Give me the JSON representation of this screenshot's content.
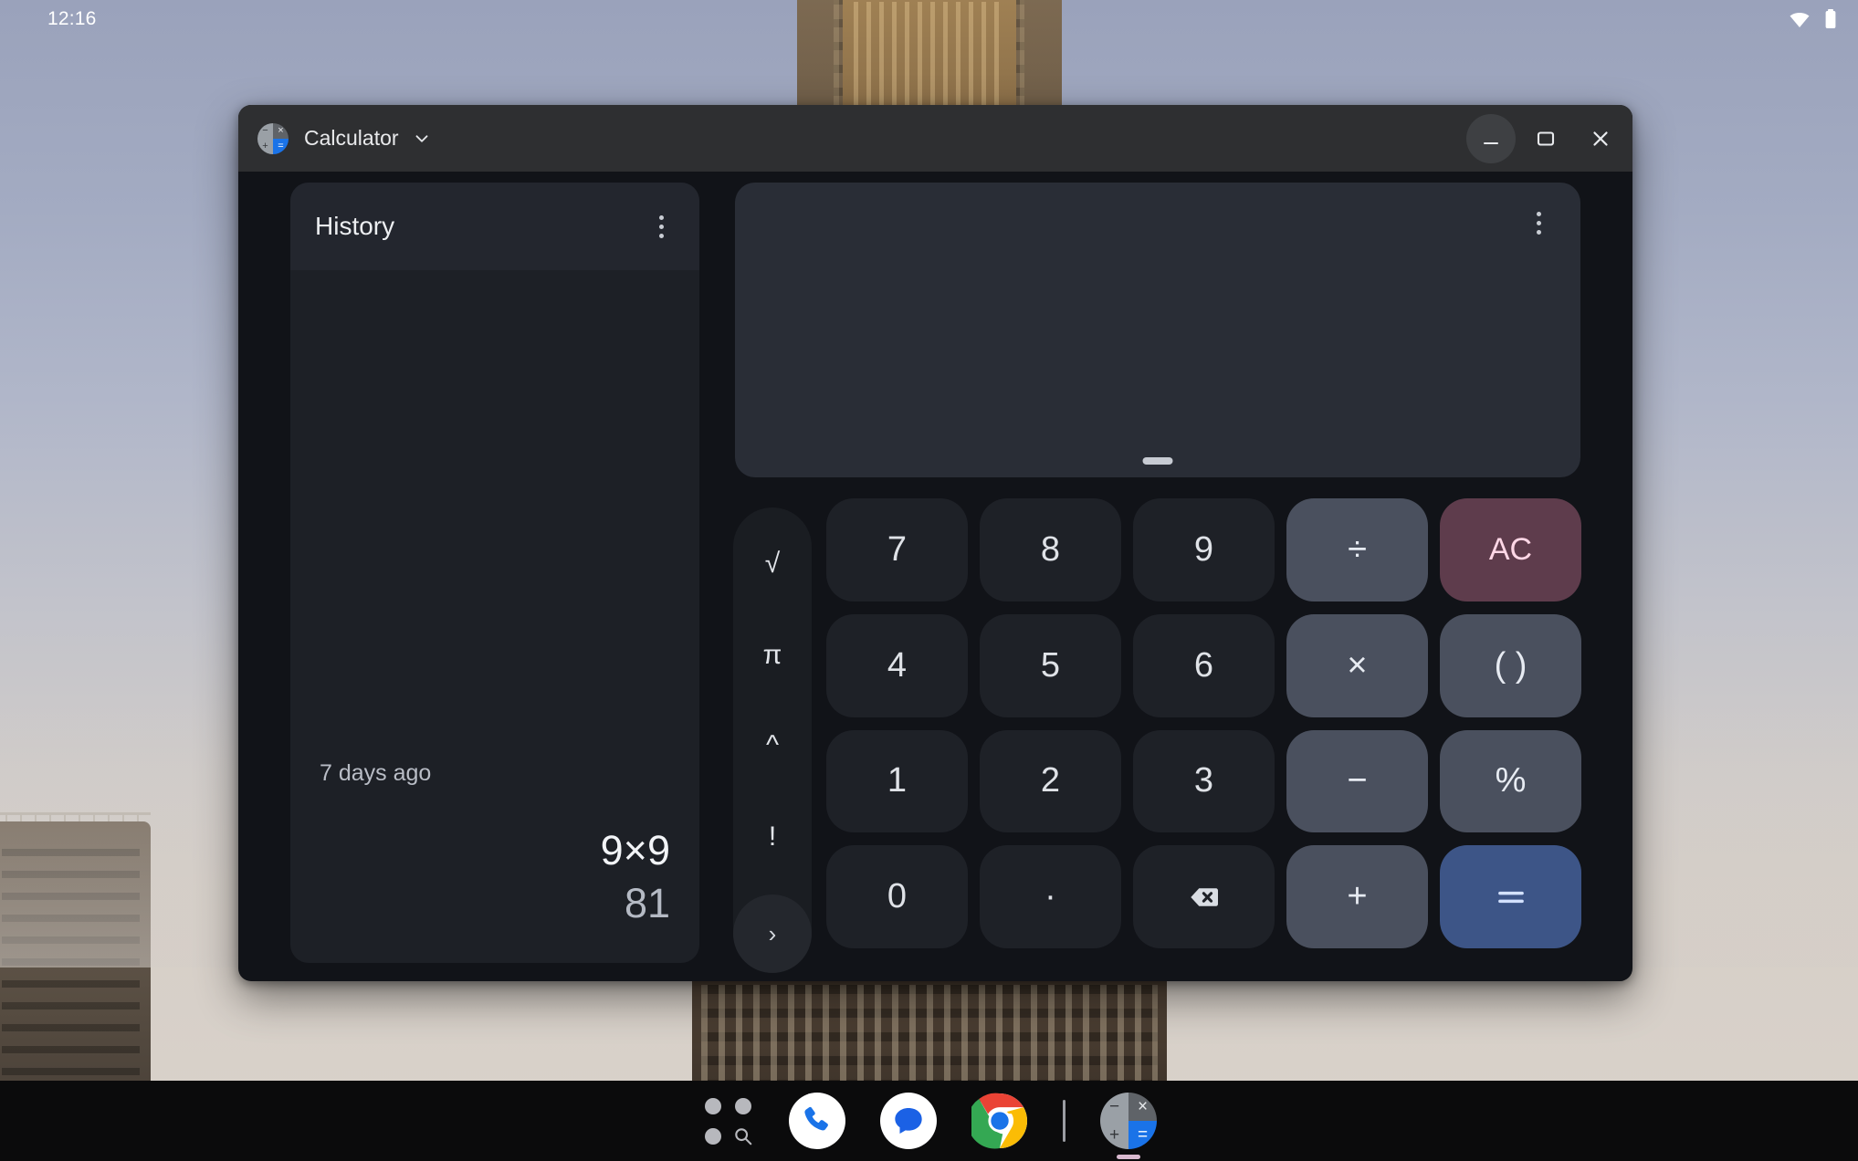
{
  "status_bar": {
    "clock": "12:16",
    "icons": [
      {
        "name": "wifi-icon",
        "state": "full"
      },
      {
        "name": "battery-icon",
        "state": "full"
      }
    ]
  },
  "window": {
    "title": "Calculator",
    "app_icon": "calculator-icon",
    "title_menu_icon": "chevron-down-icon",
    "controls": [
      {
        "name": "minimize-button",
        "icon": "minimize-icon",
        "hover": true
      },
      {
        "name": "maximize-button",
        "icon": "maximize-icon",
        "hover": false
      },
      {
        "name": "close-button",
        "icon": "close-icon",
        "hover": false
      }
    ]
  },
  "history": {
    "title": "History",
    "overflow_icon": "more-vert-icon",
    "entries": [
      {
        "date": "7 days ago",
        "expression": "9×9",
        "result": "81"
      }
    ]
  },
  "display": {
    "expression": "",
    "result": "",
    "overflow_icon": "more-vert-icon",
    "drag_handle": "drag-handle"
  },
  "function_rail": {
    "keys": [
      {
        "label": "√",
        "name": "sqrt-key"
      },
      {
        "label": "π",
        "name": "pi-key"
      },
      {
        "label": "^",
        "name": "power-key"
      },
      {
        "label": "!",
        "name": "factorial-key"
      }
    ],
    "expand": {
      "label": "›",
      "name": "expand-functions-key"
    }
  },
  "keypad": {
    "rows": [
      [
        {
          "label": "7",
          "name": "key-7",
          "type": "num"
        },
        {
          "label": "8",
          "name": "key-8",
          "type": "num"
        },
        {
          "label": "9",
          "name": "key-9",
          "type": "num"
        },
        {
          "label": "÷",
          "name": "key-divide",
          "type": "op"
        },
        {
          "label": "AC",
          "name": "key-all-clear",
          "type": "ac"
        }
      ],
      [
        {
          "label": "4",
          "name": "key-4",
          "type": "num"
        },
        {
          "label": "5",
          "name": "key-5",
          "type": "num"
        },
        {
          "label": "6",
          "name": "key-6",
          "type": "num"
        },
        {
          "label": "×",
          "name": "key-multiply",
          "type": "op"
        },
        {
          "label": "( )",
          "name": "key-parentheses",
          "type": "op"
        }
      ],
      [
        {
          "label": "1",
          "name": "key-1",
          "type": "num"
        },
        {
          "label": "2",
          "name": "key-2",
          "type": "num"
        },
        {
          "label": "3",
          "name": "key-3",
          "type": "num"
        },
        {
          "label": "−",
          "name": "key-subtract",
          "type": "op"
        },
        {
          "label": "%",
          "name": "key-percent",
          "type": "op"
        }
      ],
      [
        {
          "label": "0",
          "name": "key-0",
          "type": "num"
        },
        {
          "label": "·",
          "name": "key-decimal",
          "type": "num"
        },
        {
          "label": "",
          "name": "key-backspace",
          "type": "num",
          "icon": "backspace-icon"
        },
        {
          "label": "+",
          "name": "key-add",
          "type": "op"
        },
        {
          "label": "=",
          "name": "key-equals",
          "type": "eq"
        }
      ]
    ]
  },
  "shelf": {
    "items": [
      {
        "name": "launcher-button",
        "icon": "launcher-search-icon"
      },
      {
        "name": "shelf-app-phone",
        "icon": "phone-icon"
      },
      {
        "name": "shelf-app-messages",
        "icon": "messages-icon"
      },
      {
        "name": "shelf-app-chrome",
        "icon": "chrome-icon"
      },
      {
        "name": "shelf-divider",
        "icon": "divider"
      },
      {
        "name": "shelf-app-calculator",
        "icon": "calculator-icon",
        "running": true
      }
    ]
  },
  "colors": {
    "window_body": "#111318",
    "titlebar": "#2e2f31",
    "panel": "#1d2026",
    "panel_header": "#23262e",
    "display": "#292d36",
    "key_num": "#1e2127",
    "key_op": "#4a505e",
    "key_ac_bg": "#5e3c4c",
    "key_ac_fg": "#ffd7e6",
    "key_equals": "#3d5587",
    "shelf": "#0b0b0c"
  }
}
